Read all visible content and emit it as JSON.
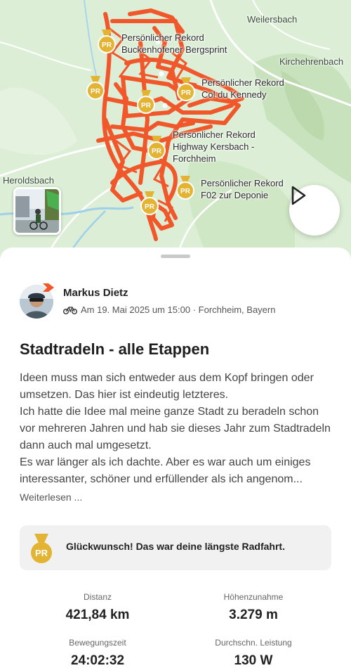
{
  "map": {
    "places": [
      "Weilersbach",
      "Kirchehrenbach",
      "Heroldsbach"
    ],
    "records": [
      {
        "line1": "Persönlicher Rekord",
        "line2": "Buckenhofener Bergsprint",
        "line3": ""
      },
      {
        "line1": "Persönlicher Rekord",
        "line2": "Col du Kennedy",
        "line3": ""
      },
      {
        "line1": "Persönlicher Rekord",
        "line2": "Highway Kersbach -",
        "line3": "Forchheim"
      },
      {
        "line1": "Persönlicher Rekord",
        "line2": "F02 zur Deponie",
        "line3": ""
      }
    ],
    "badge_text": "PR",
    "route_color": "#f0572a",
    "badge_color": "#e3b333"
  },
  "activity": {
    "athlete": "Markus Dietz",
    "meta": "Am 19. Mai 2025 um 15:00 · Forchheim, Bayern",
    "title": "Stadtradeln - alle Etappen",
    "description": [
      "Ideen muss man sich entweder aus dem Kopf bringen oder umsetzen. Das hier ist eindeutig letzteres.",
      "Ich hatte die Idee mal meine ganze Stadt zu beradeln schon vor mehreren Jahren und hab sie dieses Jahr zum Stadtradeln dann auch mal umgesetzt.",
      "Es war länger als ich dachte. Aber es war auch um einiges interessanter, schöner und erfüllender als ich angenom..."
    ],
    "read_more": "Weiterlesen ...",
    "banner": "Glückwunsch! Das war deine längste Radfahrt."
  },
  "stats": [
    {
      "label": "Distanz",
      "value": "421,84 km"
    },
    {
      "label": "Höhenzunahme",
      "value": "3.279 m"
    },
    {
      "label": "Bewegungszeit",
      "value": "24:02:32"
    },
    {
      "label": "Durchschn. Leistung",
      "value": "130 W"
    }
  ]
}
